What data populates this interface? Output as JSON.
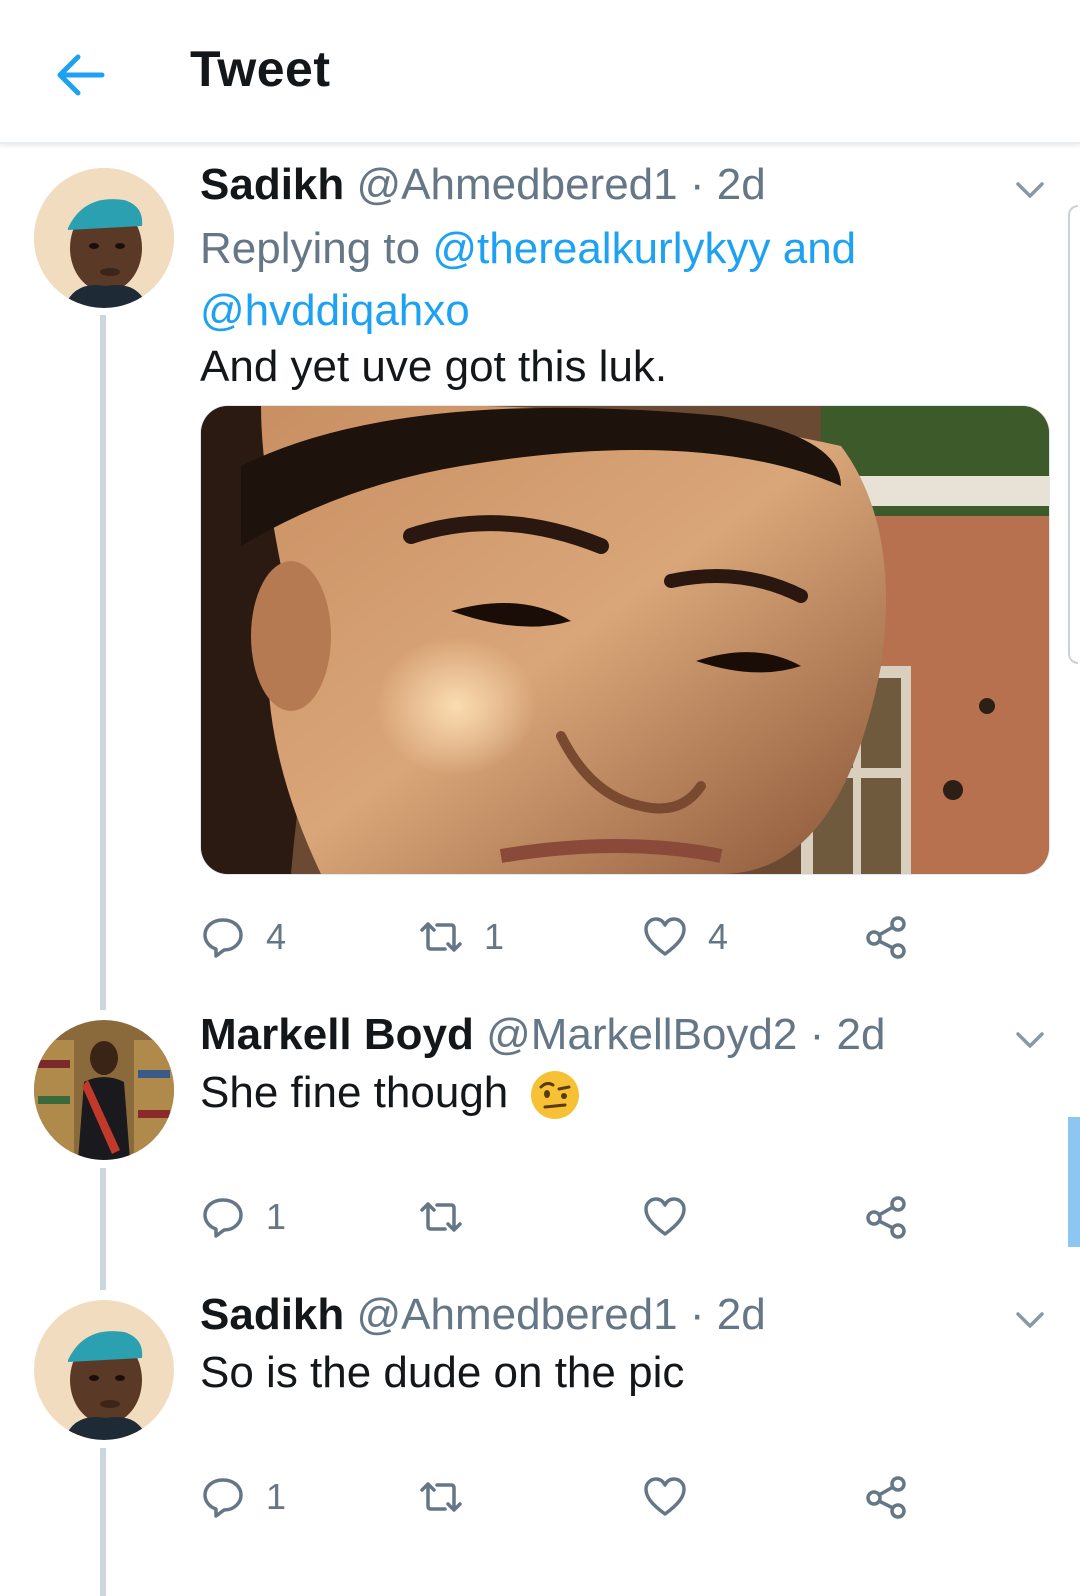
{
  "header": {
    "title": "Tweet",
    "back_icon": "arrow-left-icon"
  },
  "colors": {
    "accent": "#1da1f2",
    "secondary_text": "#657786",
    "primary_text": "#14171a"
  },
  "tweets": [
    {
      "name": "Sadikh",
      "handle": "@Ahmedbered1",
      "dot": "·",
      "time": "2d",
      "replying_prefix": "Replying to",
      "replying_to_1": "@therealkurlykyy",
      "replying_and": "and",
      "replying_to_2": "@hvddiqahxo",
      "text": "And yet uve got this luk.",
      "replies": "4",
      "retweets": "1",
      "likes": "4"
    },
    {
      "name": "Markell Boyd",
      "handle": "@MarkellBoyd2",
      "dot": "·",
      "time": "2d",
      "text": "She fine though",
      "emoji": "raised-eyebrow-emoji",
      "replies": "1",
      "retweets": "",
      "likes": ""
    },
    {
      "name": "Sadikh",
      "handle": "@Ahmedbered1",
      "dot": "·",
      "time": "2d",
      "text": "So is the dude on the pic",
      "replies": "1",
      "retweets": "",
      "likes": ""
    }
  ]
}
